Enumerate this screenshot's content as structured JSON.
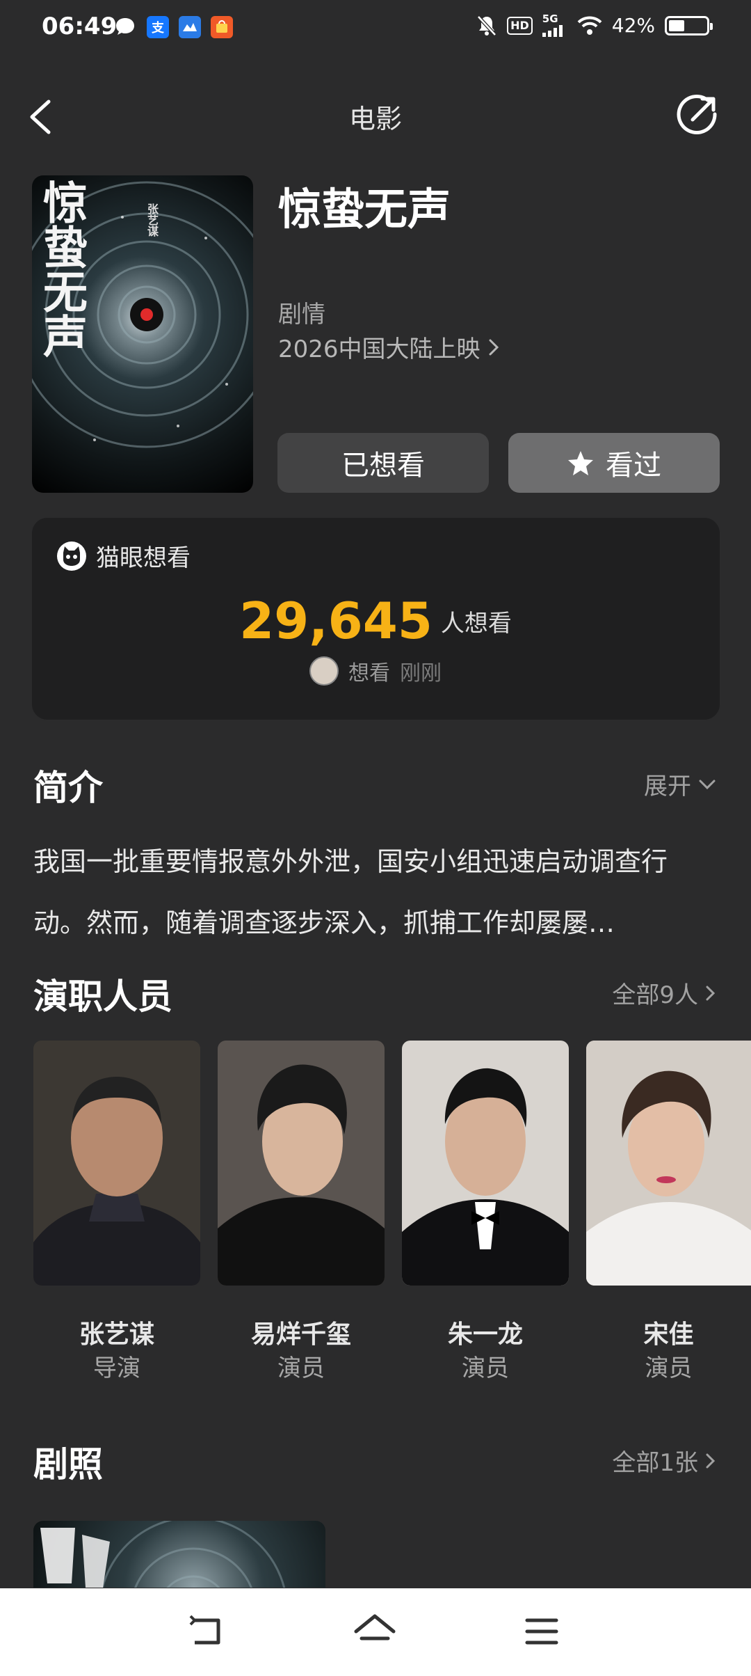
{
  "status": {
    "time": "06:49",
    "network": "5G",
    "battery": "42%",
    "battery_level": 0.42,
    "hd": "HD"
  },
  "nav": {
    "title": "电影"
  },
  "movie": {
    "title": "惊蛰无声",
    "genre": "剧情",
    "release": "2026中国大陆上映",
    "poster_text": "惊蛰无声",
    "poster_credit": "张艺谋"
  },
  "actions": {
    "wanted_label": "已想看",
    "watched_label": "看过"
  },
  "want": {
    "source_label": "猫眼想看",
    "count": "29,645",
    "count_unit": "人想看",
    "recent_action": "想看",
    "recent_time": "刚刚"
  },
  "synopsis": {
    "title": "简介",
    "expand_label": "展开",
    "text": "我国一批重要情报意外外泄，国安小组迅速启动调查行动。然而，随着调查逐步深入，抓捕工作却屡屡…"
  },
  "cast": {
    "title": "演职人员",
    "all_label": "全部9人",
    "members": [
      {
        "name": "张艺谋",
        "role": "导演"
      },
      {
        "name": "易烊千玺",
        "role": "演员"
      },
      {
        "name": "朱一龙",
        "role": "演员"
      },
      {
        "name": "宋佳",
        "role": "演员"
      }
    ]
  },
  "stills": {
    "title": "剧照",
    "all_label": "全部1张"
  },
  "colors": {
    "accent": "#f7b216",
    "background": "#2b2b2c",
    "card": "#1f1f20"
  }
}
